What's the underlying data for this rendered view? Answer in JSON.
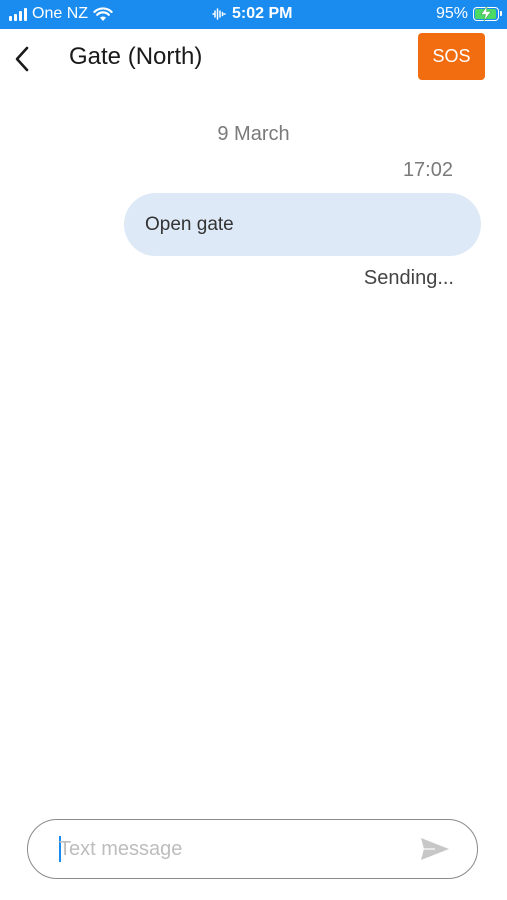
{
  "status_bar": {
    "carrier": "One NZ",
    "time": "5:02 PM",
    "battery": "95%",
    "battery_level": 0.95,
    "icons": [
      "signal-icon",
      "wifi-icon",
      "activity-icon",
      "battery-charging-icon"
    ]
  },
  "header": {
    "title": "Gate (North)",
    "back_icon": "chevron-left-icon",
    "sos_label": "SOS"
  },
  "conversation": {
    "date": "9 March",
    "messages": [
      {
        "time": "17:02",
        "text": "Open gate",
        "status": "Sending..."
      }
    ]
  },
  "composer": {
    "placeholder": "Text message",
    "value": "",
    "send_icon": "send-icon"
  },
  "colors": {
    "status_bar_bg": "#1a8cf0",
    "sos_bg": "#f26d0f",
    "bubble_bg": "#dde9f6",
    "battery_fill": "#4cd964"
  }
}
